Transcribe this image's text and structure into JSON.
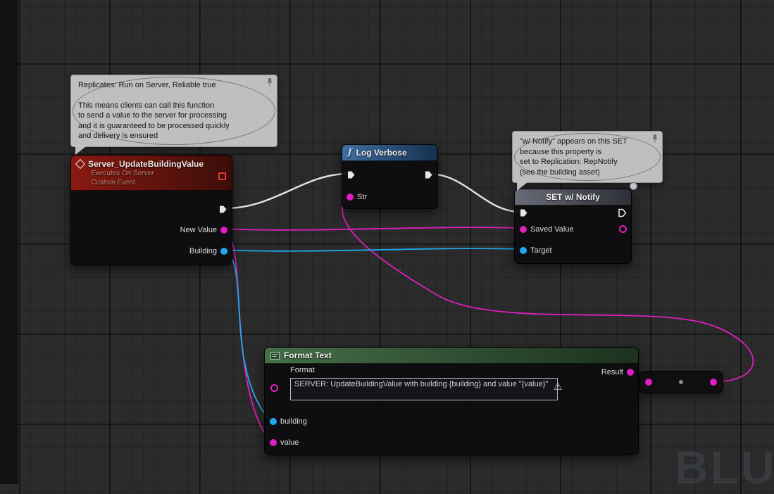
{
  "watermark": "BLUEPRINT",
  "colors": {
    "exec_wire": "#e3e3e3",
    "text_pin": "#dc1fbe",
    "object_pin": "#22a7ee",
    "event_header": "#8a1a12",
    "function_header": "#3f6fa3",
    "set_header": "#696c78",
    "format_header": "#456f49",
    "delegate_pin": "#e0392b"
  },
  "comments": {
    "replicates": {
      "lines": [
        "Replicates: Run on Server, Reliable true",
        "",
        "This means clients can call this function",
        "to send a value to the server for processing",
        "and it is guaranteed to be processed quickly",
        "and delivery is ensured"
      ]
    },
    "notify": {
      "lines": [
        "\"w/ Notify\" appears on this SET",
        "because this property is",
        "set to Replication: RepNotify",
        "(see the building asset)"
      ]
    }
  },
  "nodes": {
    "event": {
      "title": "Server_UpdateBuildingValue",
      "subtitle1": "Executes On Server",
      "subtitle2": "Custom Event",
      "pin_new_value": "New Value",
      "pin_building": "Building"
    },
    "log": {
      "title": "Log Verbose",
      "pin_str": "Str"
    },
    "set": {
      "title": "SET w/ Notify",
      "pin_saved_value": "Saved Value",
      "pin_target": "Target"
    },
    "format": {
      "title": "Format Text",
      "format_label": "Format",
      "format_value": "SERVER: UpdateBuildingValue with building {building} and value \"{value}\"",
      "pin_building": "building",
      "pin_value": "value",
      "pin_result": "Result"
    }
  }
}
